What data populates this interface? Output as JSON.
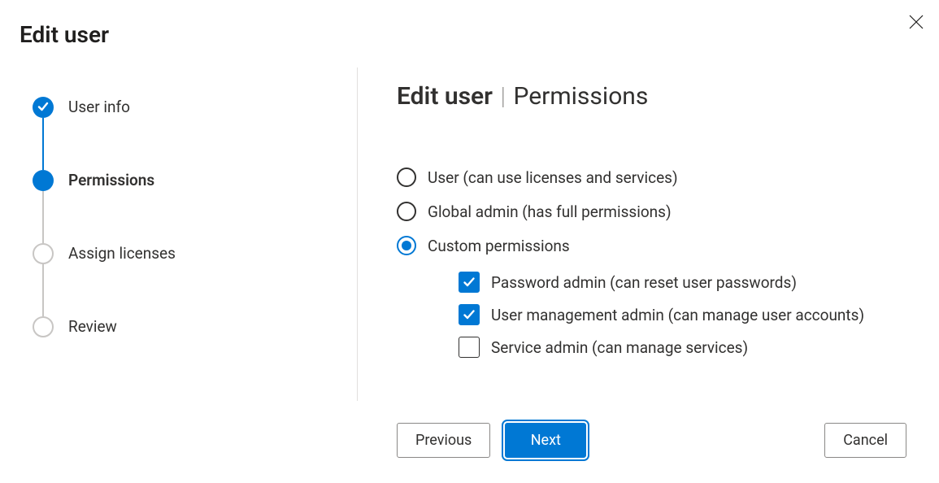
{
  "dialog": {
    "title": "Edit user"
  },
  "stepper": {
    "steps": [
      {
        "label": "User info",
        "state": "completed"
      },
      {
        "label": "Permissions",
        "state": "active"
      },
      {
        "label": "Assign licenses",
        "state": "upcoming"
      },
      {
        "label": "Review",
        "state": "upcoming"
      }
    ]
  },
  "content": {
    "title_strong": "Edit user",
    "title_rest": "Permissions",
    "permission_options": [
      {
        "label": "User (can use licenses and services)",
        "selected": false
      },
      {
        "label": "Global admin (has full permissions)",
        "selected": false
      },
      {
        "label": "Custom permissions",
        "selected": true
      }
    ],
    "custom_permissions": [
      {
        "label": "Password admin (can reset user passwords)",
        "checked": true
      },
      {
        "label": "User management admin (can manage user accounts)",
        "checked": true
      },
      {
        "label": "Service admin (can manage services)",
        "checked": false
      }
    ]
  },
  "footer": {
    "previous": "Previous",
    "next": "Next",
    "cancel": "Cancel"
  }
}
